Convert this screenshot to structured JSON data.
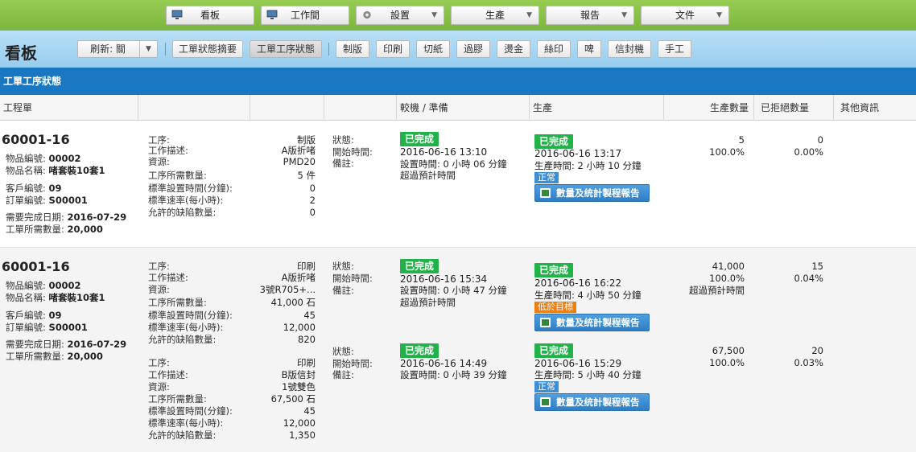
{
  "topnav": {
    "items": [
      {
        "label": "看板",
        "icon": "monitor-icon"
      },
      {
        "label": "工作間",
        "icon": "monitor-icon"
      },
      {
        "label": "設置",
        "icon": "gear-icon",
        "dropdown": true
      },
      {
        "label": "生產",
        "dropdown": true
      },
      {
        "label": "報告",
        "dropdown": true
      },
      {
        "label": "文件",
        "dropdown": true
      }
    ]
  },
  "toolbar": {
    "title": "看板",
    "refresh_label": "刷新: 關",
    "buttons": [
      "工單狀態摘要",
      "工單工序狀態",
      "制版",
      "印刷",
      "切紙",
      "過膠",
      "燙金",
      "絲印",
      "啤",
      "信封機",
      "手工"
    ],
    "active": "工單工序狀態"
  },
  "section_title": "工單工序狀態",
  "columns": [
    "工程單",
    "",
    "",
    "",
    "較機 / 準備",
    "生產",
    "生產數量",
    "已拒絕數量",
    "其他資訊"
  ],
  "labels": {
    "item_no": "物品編號:",
    "item_name": "物品名稱:",
    "customer_no": "客戶編號:",
    "order_no": "訂單編號:",
    "due_date": "需要完成日期:",
    "qty_required": "工單所需數量:",
    "process": "工序:",
    "work_desc": "工作描述:",
    "resource": "資源:",
    "proc_qty": "工序所需數量:",
    "std_setup": "標準設置時間(分鐘):",
    "std_rate": "標準速率(每小時):",
    "allowed_defects": "允許的缺陷數量:",
    "status": "狀態:",
    "start_time": "開始時間:",
    "remarks": "備註:",
    "report_button": "數量及统計製程報告"
  },
  "orders": [
    {
      "wo": "60001-16",
      "item_no": "00002",
      "item_name": "啫套裝10套1",
      "customer_no": "09",
      "order_no": "S00001",
      "due_date": "2016-07-29",
      "qty_required": "20,000",
      "ops": [
        {
          "process": "制版",
          "work_desc": "A版折啫",
          "resource": "PMD20",
          "proc_qty": "5 件",
          "std_setup": "0",
          "std_rate": "2",
          "allowed_defects": "0",
          "setup": {
            "status": "已完成",
            "start": "2016-06-16 13:10",
            "duration": "設置時間: 0 小時 06 分鐘",
            "note": "超過預計時間"
          },
          "prod": {
            "status": "已完成",
            "start": "2016-06-16 13:17",
            "duration": "生產時間: 2 小時 10 分鐘",
            "tag": "正常",
            "tag_color": "blue"
          },
          "qty": "5",
          "qty_pct": "100.0%",
          "qty_note": "",
          "rejected": "0",
          "rejected_pct": "0.00%"
        }
      ]
    },
    {
      "wo": "60001-16",
      "item_no": "00002",
      "item_name": "啫套裝10套1",
      "customer_no": "09",
      "order_no": "S00001",
      "due_date": "2016-07-29",
      "qty_required": "20,000",
      "ops": [
        {
          "process": "印刷",
          "work_desc": "A版折啫",
          "resource": "3號R705+...",
          "proc_qty": "41,000 石",
          "std_setup": "45",
          "std_rate": "12,000",
          "allowed_defects": "820",
          "setup": {
            "status": "已完成",
            "start": "2016-06-16 15:34",
            "duration": "設置時間: 0 小時 47 分鐘",
            "note": "超過預計時間"
          },
          "prod": {
            "status": "已完成",
            "start": "2016-06-16 16:22",
            "duration": "生產時間: 4 小時 50 分鐘",
            "tag": "低於目標",
            "tag_color": "orange"
          },
          "qty": "41,000",
          "qty_pct": "100.0%",
          "qty_note": "超過預計時間",
          "rejected": "15",
          "rejected_pct": "0.04%"
        },
        {
          "process": "印刷",
          "work_desc": "B版信封",
          "resource": "1號雙色",
          "proc_qty": "67,500 石",
          "std_setup": "45",
          "std_rate": "12,000",
          "allowed_defects": "1,350",
          "setup": {
            "status": "已完成",
            "start": "2016-06-16 14:49",
            "duration": "設置時間: 0 小時 39 分鐘",
            "note": ""
          },
          "prod": {
            "status": "已完成",
            "start": "2016-06-16 15:29",
            "duration": "生產時間: 5 小時 40 分鐘",
            "tag": "正常",
            "tag_color": "blue"
          },
          "qty": "67,500",
          "qty_pct": "100.0%",
          "qty_note": "",
          "rejected": "20",
          "rejected_pct": "0.03%"
        }
      ]
    }
  ],
  "colors": {
    "nav_green": "#8bc34a",
    "toolbar_blue": "#a9d8f5",
    "section_blue": "#1a78c2",
    "status_green": "#21b24a",
    "tag_blue": "#3a8fd6",
    "tag_orange": "#ee7d12"
  }
}
